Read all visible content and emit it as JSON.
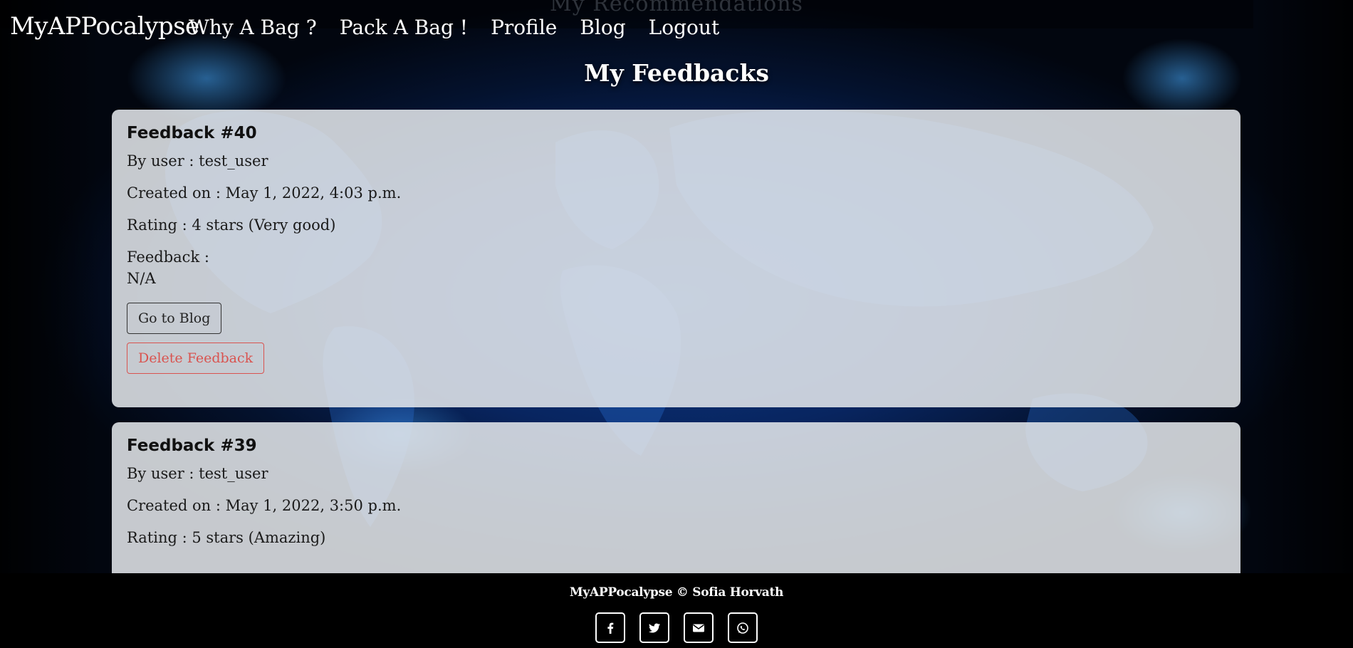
{
  "nav": {
    "ghost_title": "My Recommendations",
    "brand": "MyAPPocalypse",
    "links": [
      "Why A Bag ?",
      "Pack A Bag !",
      "Profile",
      "Blog",
      "Logout"
    ]
  },
  "page": {
    "title": "My Feedbacks"
  },
  "feedbacks": [
    {
      "title": "Feedback #40",
      "user": "By user : test_user",
      "created": "Created on : May 1, 2022, 4:03 p.m.",
      "rating": "Rating : 4 stars (Very good)",
      "feedback_label": "Feedback :",
      "feedback_text": "N/A",
      "blog_button": "Go to Blog",
      "delete_button": "Delete Feedback"
    },
    {
      "title": "Feedback #39",
      "user": "By user : test_user",
      "created": "Created on : May 1, 2022, 3:50 p.m.",
      "rating": "Rating : 5 stars (Amazing)"
    }
  ],
  "footer": {
    "copyright": "MyAPPocalypse © Sofia Horvath",
    "icons": [
      "facebook-icon",
      "twitter-icon",
      "email-icon",
      "whatsapp-icon"
    ]
  },
  "colors": {
    "danger": "#d9534f",
    "card_bg": "#e6eaee",
    "footer_bg": "#000000"
  }
}
